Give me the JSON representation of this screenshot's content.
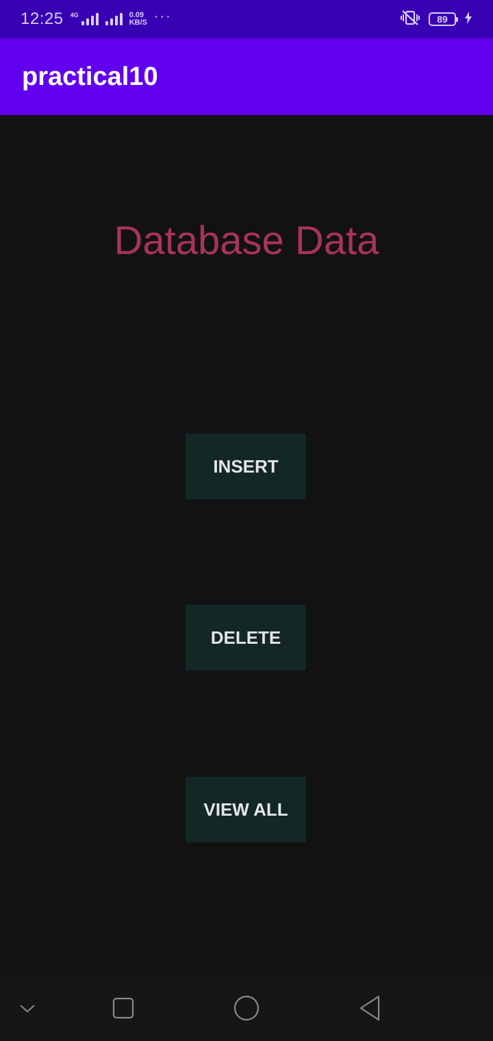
{
  "status_bar": {
    "time": "12:25",
    "network_type": "4G",
    "speed_value": "0.09",
    "speed_unit": "KB/S",
    "more": "···",
    "battery_level": "89",
    "icons": [
      "signal-icon",
      "signal-icon",
      "vibrate-icon",
      "battery-icon",
      "charging-icon"
    ]
  },
  "app_bar": {
    "title": "practical10"
  },
  "main": {
    "heading": "Database Data",
    "heading_color": "#a8325e",
    "buttons": {
      "insert": "INSERT",
      "delete": "DELETE",
      "view_all": "VIEW ALL"
    }
  },
  "nav_bar": {
    "icons": [
      "chevron-down-icon",
      "recents-icon",
      "home-icon",
      "back-icon"
    ]
  },
  "colors": {
    "status_bar": "#3700b3",
    "app_bar": "#6200ee",
    "background": "#121212",
    "button": "#132727"
  }
}
